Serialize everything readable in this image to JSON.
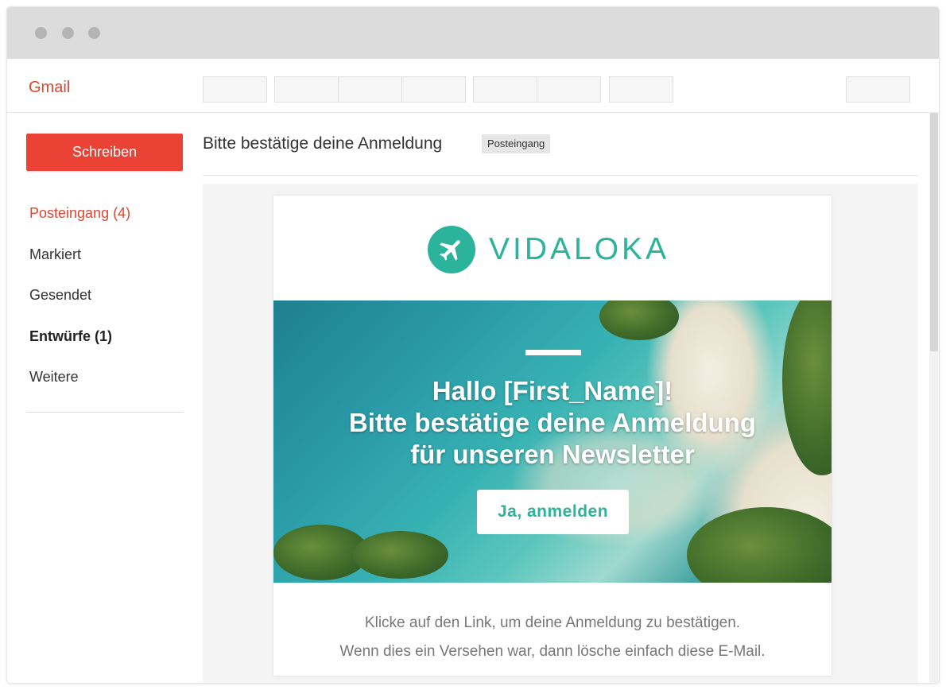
{
  "app": {
    "logo": "Gmail"
  },
  "colors": {
    "accent": "#ea4335",
    "brand": "#2bb39c"
  },
  "sidebar": {
    "compose_label": "Schreiben",
    "items": [
      {
        "label": "Posteingang (4)",
        "state": "active"
      },
      {
        "label": "Markiert"
      },
      {
        "label": "Gesendet"
      },
      {
        "label": "Entwürfe (1)",
        "state": "bold"
      },
      {
        "label": "Weitere"
      }
    ]
  },
  "message": {
    "subject": "Bitte bestätige deine Anmeldung",
    "label": "Posteingang"
  },
  "email": {
    "brand_name": "VIDALOKA",
    "brand_icon": "airplane-icon",
    "hero_line1": "Hallo [First_Name]!",
    "hero_line2": "Bitte bestätige deine Anmeldung",
    "hero_line3": "für unseren Newsletter",
    "cta_label": "Ja, anmelden",
    "body_line1": "Klicke auf den Link, um deine Anmeldung zu bestätigen.",
    "body_line2": "Wenn dies ein Versehen war, dann lösche einfach diese E-Mail."
  }
}
